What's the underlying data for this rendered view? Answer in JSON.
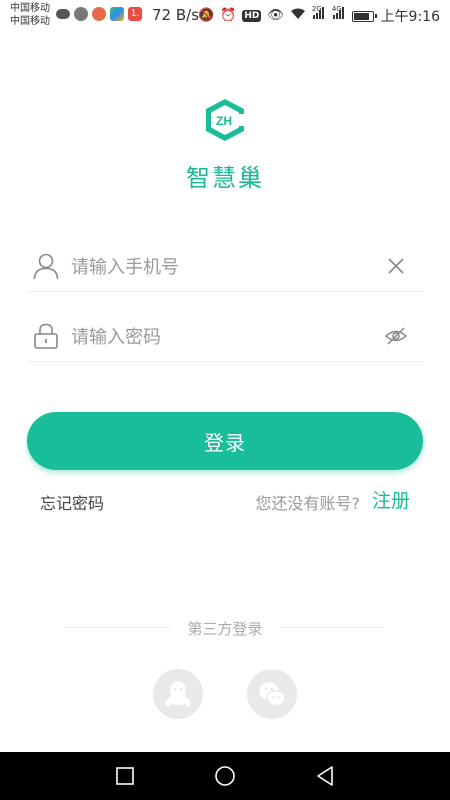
{
  "status_bar": {
    "carrier_1": "中国移动",
    "carrier_2": "中国移动",
    "net_speed": "72 B/s",
    "hd_label": "HD",
    "net_2g": "2G",
    "net_4g": "4G",
    "time": "上午9:16",
    "notification_badge": "1."
  },
  "app": {
    "name": "智慧巢",
    "logo_text": "ZH",
    "brand_color": "#1abd99"
  },
  "form": {
    "phone_placeholder": "请输入手机号",
    "phone_value": "",
    "password_placeholder": "请输入密码",
    "password_value": "",
    "login_label": "登录"
  },
  "links": {
    "forgot_password": "忘记密码",
    "no_account": "您还没有账号?",
    "register": "注册"
  },
  "third_party": {
    "label": "第三方登录",
    "providers": [
      "qq-icon",
      "wechat-icon"
    ]
  },
  "icons": {
    "user": "user-icon",
    "lock": "lock-icon",
    "clear": "clear-icon",
    "eye_off": "eye-off-icon"
  }
}
